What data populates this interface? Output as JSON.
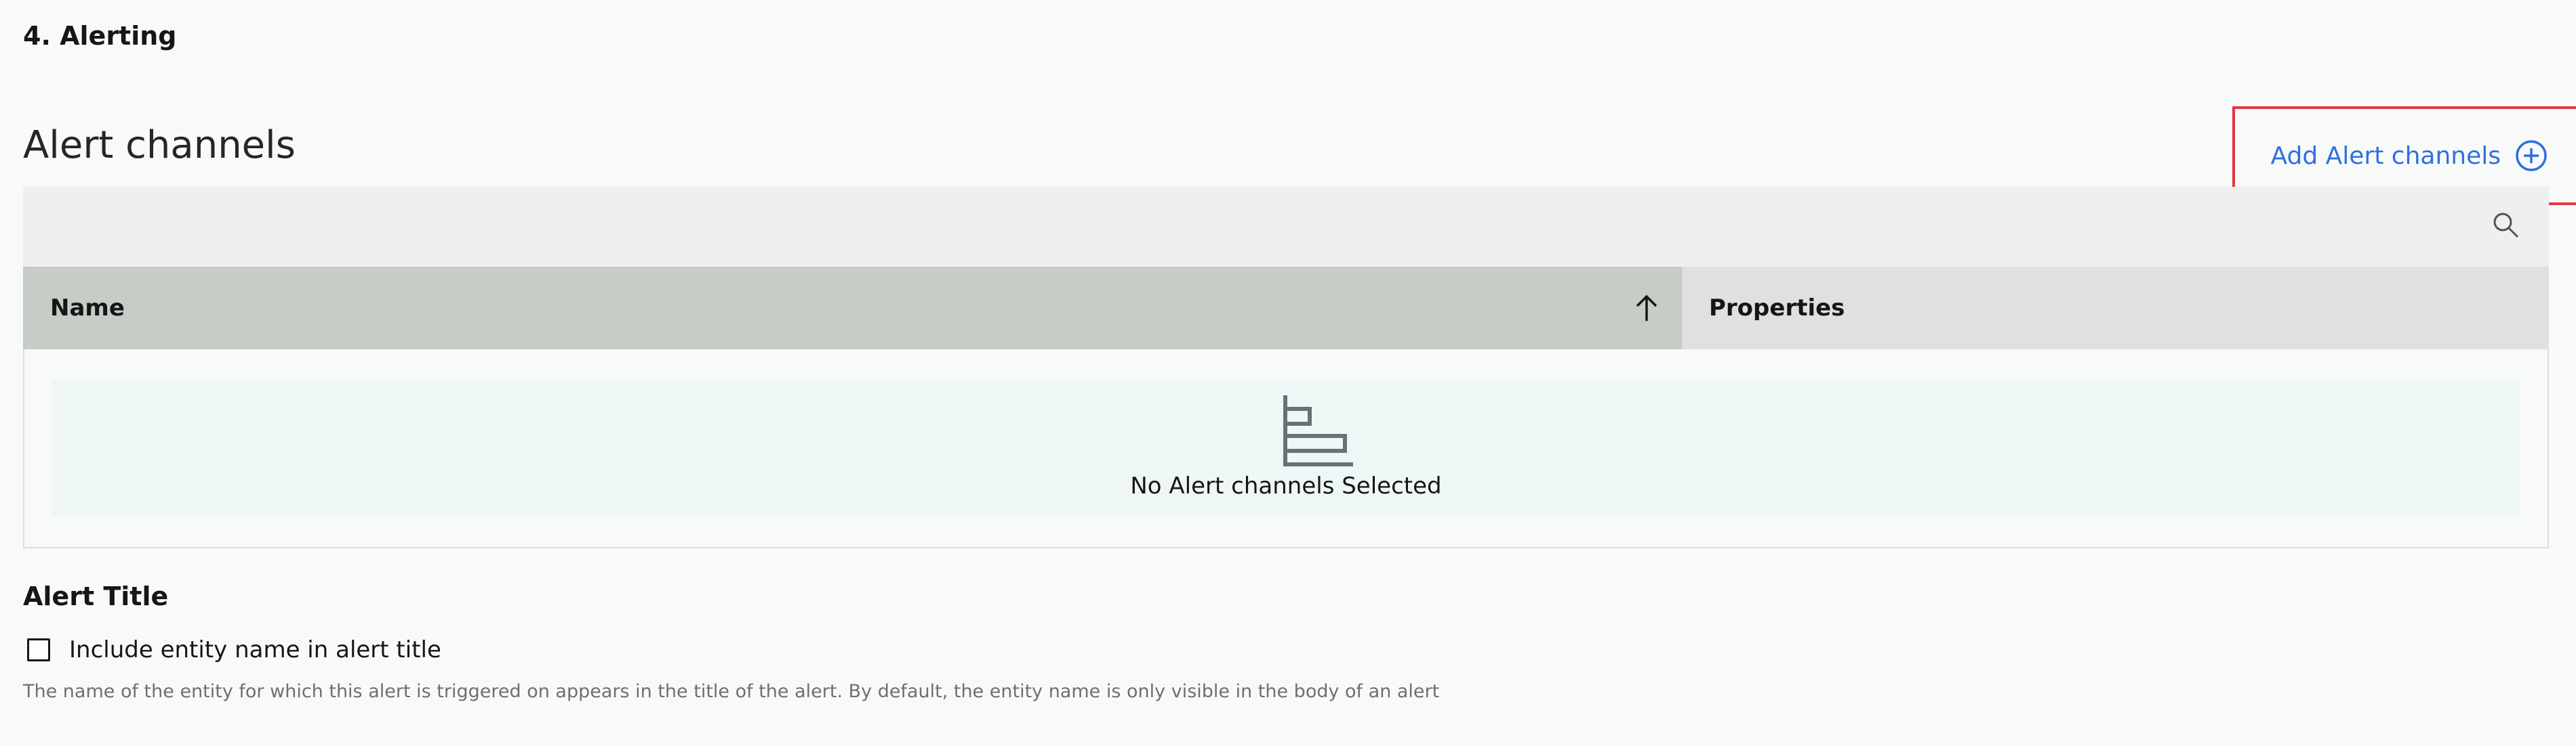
{
  "section": {
    "title": "4. Alerting"
  },
  "alert_channels": {
    "heading": "Alert channels",
    "add_button_label": "Add Alert channels",
    "add_button_icon": "add-circle-icon",
    "search_icon": "search-icon",
    "columns": [
      {
        "label": "Name",
        "sort": "ascending",
        "sort_icon": "arrow-up-icon"
      },
      {
        "label": "Properties"
      }
    ],
    "empty_state": {
      "icon": "empty-list-icon",
      "text": "No Alert channels Selected"
    }
  },
  "alert_title": {
    "heading": "Alert Title",
    "checkbox_label": "Include entity name in alert title",
    "checkbox_checked": false,
    "helper_text": "The name of the entity for which this alert is triggered on appears in the title of the alert. By default, the entity name is only visible in the body of an alert"
  },
  "colors": {
    "link": "#2f6fe0",
    "highlight_border": "#e5383b",
    "header_sorted": "#c6ccc6",
    "header": "#dfe0df",
    "toolbar": "#efefef",
    "empty_state_bg": "#eef7f6"
  }
}
